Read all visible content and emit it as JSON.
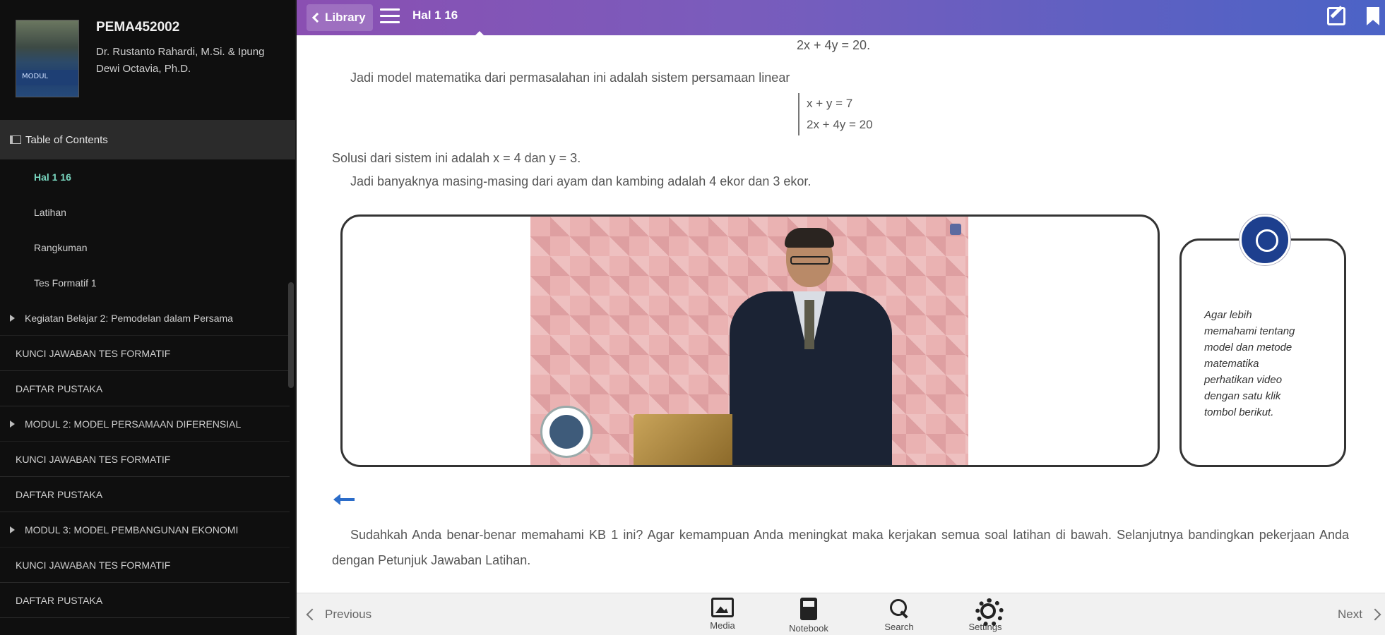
{
  "sidebar": {
    "book_code": "PEMA452002",
    "book_authors": "Dr. Rustanto Rahardi, M.Si. & Ipung Dewi Octavia, Ph.D.",
    "cover_text": "MODUL",
    "toc_title": "Table of Contents",
    "items": [
      {
        "label": "Hal 1 16"
      },
      {
        "label": "Latihan"
      },
      {
        "label": "Rangkuman"
      },
      {
        "label": "Tes Formatif 1"
      },
      {
        "label": "Kegiatan Belajar 2: Pemodelan dalam Persama"
      },
      {
        "label": "KUNCI JAWABAN TES FORMATIF"
      },
      {
        "label": "DAFTAR PUSTAKA"
      },
      {
        "label": "MODUL 2: MODEL PERSAMAAN DIFERENSIAL"
      },
      {
        "label": "KUNCI JAWABAN TES FORMATIF"
      },
      {
        "label": "DAFTAR PUSTAKA"
      },
      {
        "label": "MODUL 3: MODEL PEMBANGUNAN EKONOMI"
      },
      {
        "label": "KUNCI JAWABAN TES FORMATIF"
      },
      {
        "label": "DAFTAR PUSTAKA"
      }
    ]
  },
  "topbar": {
    "library_label": "Library",
    "page_label": "Hal 1 16"
  },
  "content": {
    "eq_top": "2x + 4y = 20.",
    "sentence1": "Jadi model matematika dari permasalahan ini adalah sistem persamaan linear",
    "system_line1": "x + y = 7",
    "system_line2": "2x + 4y = 20",
    "solution": "Solusi dari sistem ini adalah x = 4 dan y = 3.",
    "sentence2": "Jadi banyaknya masing-masing dari ayam dan kambing adalah 4 ekor dan 3 ekor.",
    "note_text": "Agar lebih memahami tentang model dan metode matematika perhatikan video dengan satu klik tombol berikut.",
    "paragraph": "Sudahkah Anda benar-benar memahami KB 1 ini? Agar kemampuan Anda meningkat maka kerjakan semua soal latihan di bawah. Selanjutnya bandingkan pekerjaan Anda dengan Petunjuk Jawaban Latihan."
  },
  "bottombar": {
    "prev_label": "Previous",
    "next_label": "Next",
    "tools": [
      {
        "label": "Media",
        "icon": "media-icon"
      },
      {
        "label": "Notebook",
        "icon": "notebook-icon"
      },
      {
        "label": "Search",
        "icon": "search-icon"
      },
      {
        "label": "Settings",
        "icon": "gear-icon"
      }
    ]
  },
  "colors": {
    "topbar_start": "#8a4fb2",
    "topbar_end": "#4b63c6",
    "active_toc": "#79d6bf",
    "back_arrow": "#2b6cc9"
  }
}
